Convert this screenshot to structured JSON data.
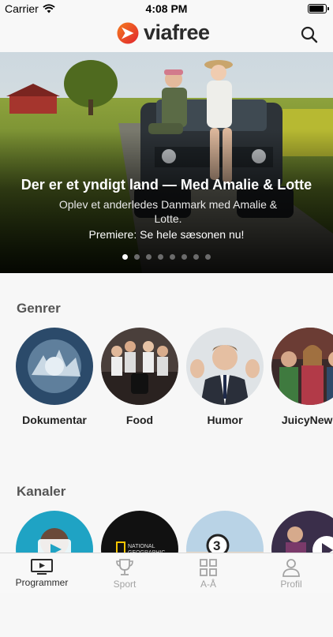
{
  "status_bar": {
    "carrier": "Carrier",
    "time": "4:08 PM"
  },
  "header": {
    "brand": "viafree"
  },
  "hero": {
    "title": "Der er et yndigt land — Med Amalie & Lotte",
    "description": "Oplev et anderledes Danmark med Amalie & Lotte.",
    "cta": "Premiere: Se hele sæsonen nu!",
    "slide_count": 8,
    "active_slide": 0
  },
  "genres": {
    "title": "Genrer",
    "items": [
      {
        "label": "Dokumentar"
      },
      {
        "label": "Food"
      },
      {
        "label": "Humor"
      },
      {
        "label": "JuicyNews"
      }
    ]
  },
  "channels": {
    "title": "Kanaler",
    "items": [
      {
        "label": ""
      },
      {
        "label": ""
      },
      {
        "label": ""
      },
      {
        "label": ""
      }
    ]
  },
  "tabbar": {
    "items": [
      {
        "label": "Programmer",
        "icon": "tv-play-icon",
        "active": true
      },
      {
        "label": "Sport",
        "icon": "trophy-icon",
        "active": false
      },
      {
        "label": "A-Å",
        "icon": "grid-icon",
        "active": false
      },
      {
        "label": "Profil",
        "icon": "person-icon",
        "active": false
      }
    ]
  },
  "colors": {
    "brand_orange": "#f15a22",
    "brand_red": "#e0242e",
    "accent_text": "#2b2b2b"
  }
}
